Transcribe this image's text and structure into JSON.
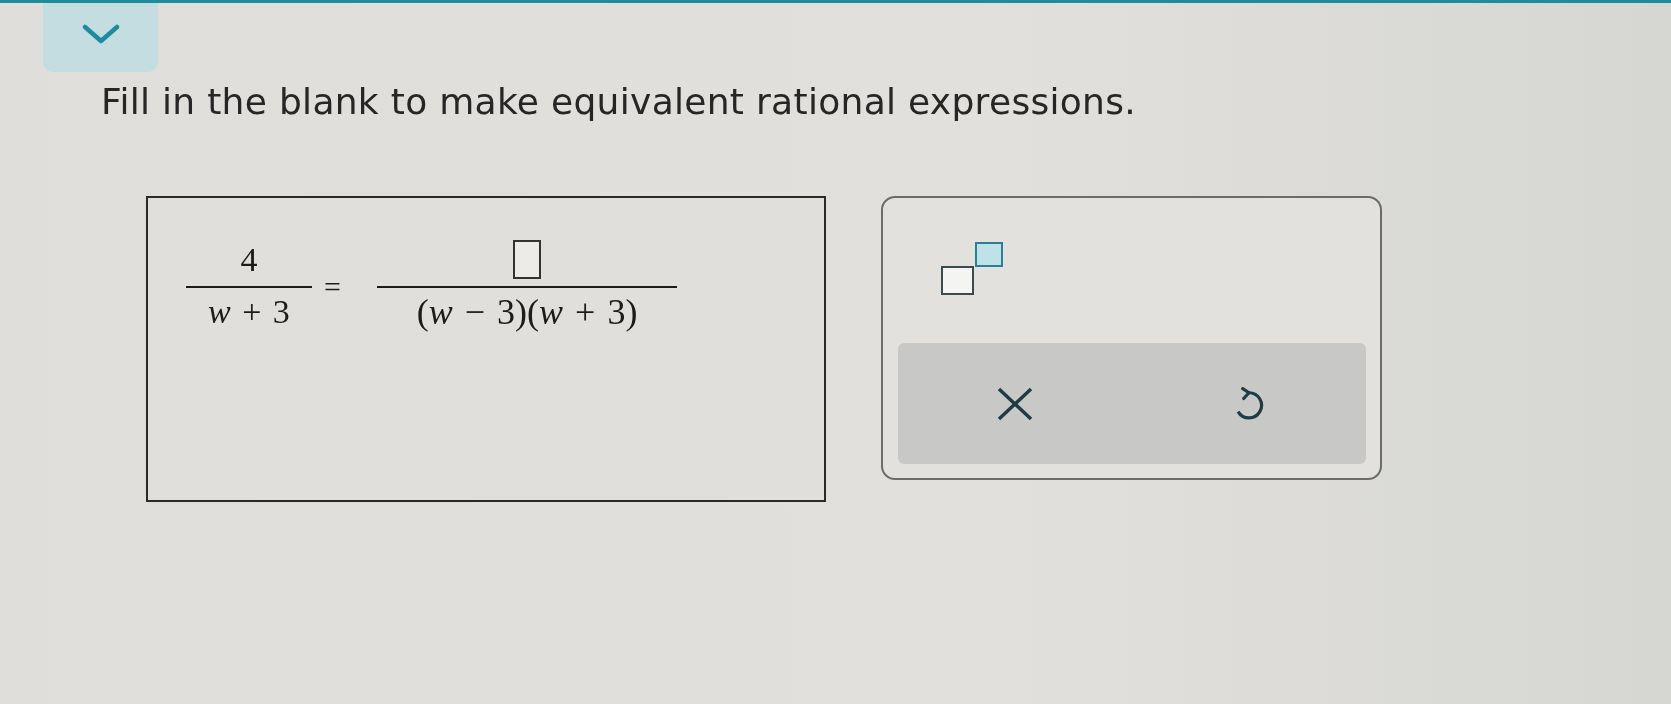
{
  "prompt": "Fill in the blank to make equivalent rational expressions.",
  "equation": {
    "left": {
      "numerator": {
        "kind": "text",
        "text": "4"
      },
      "denominator": "*w* + 3"
    },
    "relation": "=",
    "right": {
      "numerator": {
        "kind": "answer_box"
      },
      "denominator": "(*w* − 3)(*w* + 3)"
    }
  },
  "keypad": {
    "templates": [
      {
        "kind": "exponent"
      }
    ],
    "actions": [
      {
        "kind": "clear"
      },
      {
        "kind": "undo"
      }
    ]
  }
}
